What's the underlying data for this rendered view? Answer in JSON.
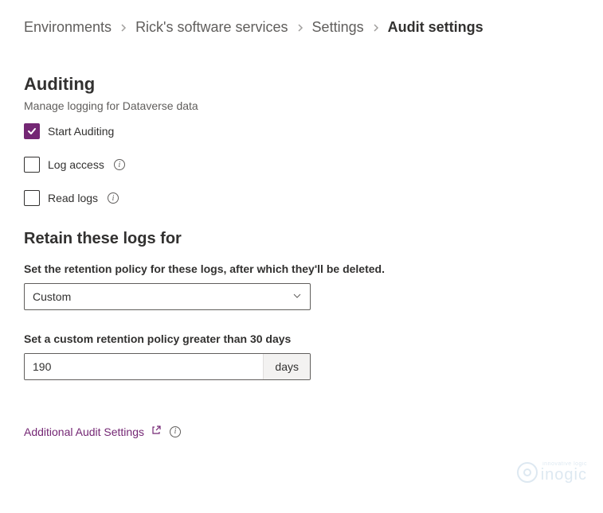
{
  "breadcrumb": {
    "items": [
      {
        "label": "Environments",
        "active": false
      },
      {
        "label": "Rick's software services",
        "active": false
      },
      {
        "label": "Settings",
        "active": false
      },
      {
        "label": "Audit settings",
        "active": true
      }
    ]
  },
  "page": {
    "title": "Auditing",
    "subtitle": "Manage logging for Dataverse data"
  },
  "auditing": {
    "start_label": "Start Auditing",
    "start_checked": true,
    "log_access_label": "Log access",
    "log_access_checked": false,
    "read_logs_label": "Read logs",
    "read_logs_checked": false
  },
  "retention": {
    "heading": "Retain these logs for",
    "policy_label": "Set the retention policy for these logs, after which they'll be deleted.",
    "policy_value": "Custom",
    "custom_label": "Set a custom retention policy greater than 30 days",
    "custom_value": "190",
    "custom_suffix": "days"
  },
  "footer": {
    "additional_link": "Additional Audit Settings"
  },
  "watermark": {
    "small": "innovative logic",
    "brand": "inogic"
  }
}
